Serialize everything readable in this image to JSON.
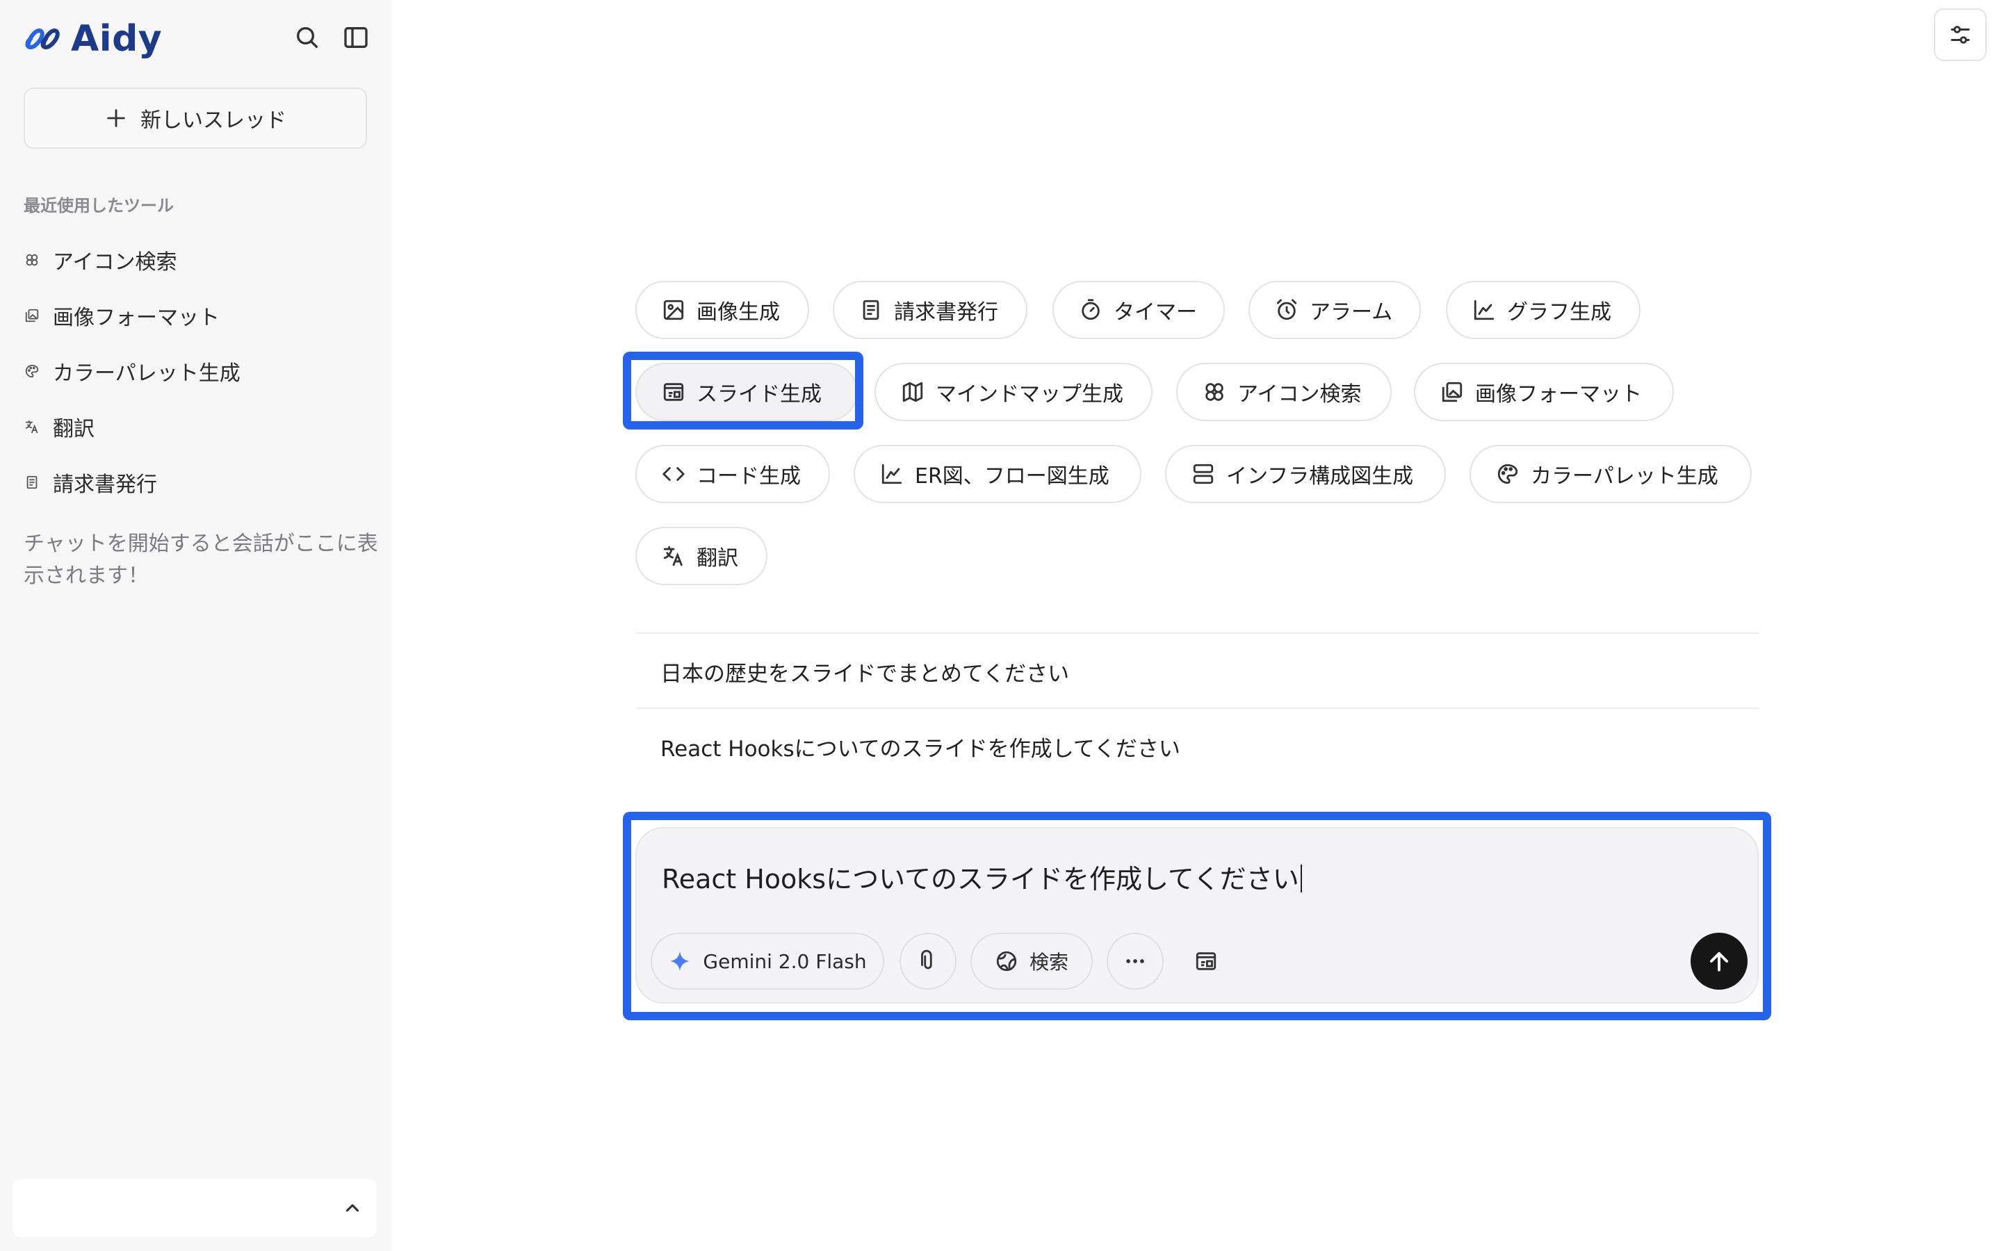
{
  "app": {
    "name": "Aidy"
  },
  "sidebar": {
    "new_thread_label": "新しいスレッド",
    "recent_heading": "最近使用したツール",
    "recent_items": [
      {
        "label": "アイコン検索",
        "icon": "flower-icon"
      },
      {
        "label": "画像フォーマット",
        "icon": "images-icon"
      },
      {
        "label": "カラーパレット生成",
        "icon": "palette-icon"
      },
      {
        "label": "翻訳",
        "icon": "translate-icon"
      },
      {
        "label": "請求書発行",
        "icon": "document-icon"
      }
    ],
    "empty_hint": "チャットを開始すると会話がここに表示されます！"
  },
  "tools": [
    {
      "label": "画像生成",
      "icon": "image-icon"
    },
    {
      "label": "請求書発行",
      "icon": "document-icon"
    },
    {
      "label": "タイマー",
      "icon": "timer-icon"
    },
    {
      "label": "アラーム",
      "icon": "alarm-icon"
    },
    {
      "label": "グラフ生成",
      "icon": "chart-icon"
    },
    {
      "label": "スライド生成",
      "icon": "slides-icon",
      "selected": true
    },
    {
      "label": "マインドマップ生成",
      "icon": "map-icon"
    },
    {
      "label": "アイコン検索",
      "icon": "flower-icon"
    },
    {
      "label": "画像フォーマット",
      "icon": "images-icon"
    },
    {
      "label": "コード生成",
      "icon": "code-icon"
    },
    {
      "label": "ER図、フロー図生成",
      "icon": "chart-icon"
    },
    {
      "label": "インフラ構成図生成",
      "icon": "server-icon"
    },
    {
      "label": "カラーパレット生成",
      "icon": "palette-icon"
    },
    {
      "label": "翻訳",
      "icon": "translate-icon"
    }
  ],
  "suggestions": [
    "日本の歴史をスライドでまとめてください",
    "React Hooksについてのスライドを作成してください"
  ],
  "composer": {
    "value": "React Hooksについてのスライドを作成してください",
    "model_label": "Gemini 2.0 Flash",
    "search_label": "検索"
  },
  "colors": {
    "highlight": "#2563eb",
    "brand": "#1e3a8a",
    "send": "#161616"
  }
}
